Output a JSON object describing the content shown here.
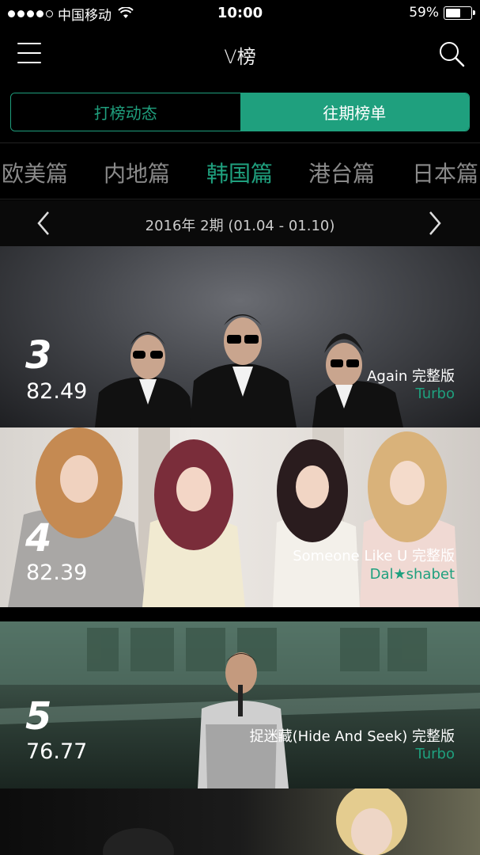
{
  "status": {
    "carrier": "中国移动",
    "time": "10:00",
    "battery": "59%",
    "battery_level": 0.59
  },
  "nav": {
    "title": "V榜",
    "menu_icon": "menu-icon",
    "search_icon": "search-icon"
  },
  "segments": {
    "left": "打榜动态",
    "right": "往期榜单",
    "selected": "往期榜单"
  },
  "regions": {
    "items": [
      "欧美篇",
      "内地篇",
      "韩国篇",
      "港台篇",
      "日本篇"
    ],
    "selected": "韩国篇"
  },
  "period": {
    "label": "2016年 2期 (01.04 - 01.10)"
  },
  "chart": {
    "items": [
      {
        "rank": "3",
        "score": "82.49",
        "song": "Again 完整版",
        "artist": "Turbo"
      },
      {
        "rank": "4",
        "score": "82.39",
        "song": "Someone Like U 完整版",
        "artist": "Dal★shabet"
      },
      {
        "rank": "5",
        "score": "76.77",
        "song": "捉迷藏(Hide And Seek) 完整版",
        "artist": "Turbo"
      }
    ]
  },
  "colors": {
    "accent": "#1fa07e",
    "background": "#000000"
  }
}
